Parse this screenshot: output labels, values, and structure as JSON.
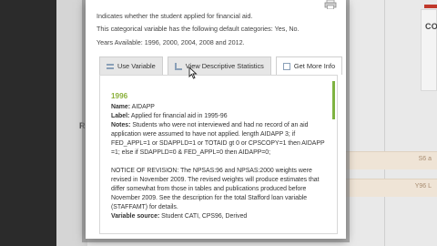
{
  "background": {
    "right_heading": "COU",
    "mid_label": "RC",
    "row_text_1": "S6 a",
    "row_text_2": "Y96 L"
  },
  "modal": {
    "desc_line_1": "Indicates whether the student applied for financial aid.",
    "desc_line_2": "This categorical variable has the following default categories: Yes, No.",
    "desc_line_3": "Years Available: 1996, 2000, 2004, 2008 and 2012.",
    "tabs": [
      {
        "label": "Use Variable"
      },
      {
        "label": "View Descriptive Statistics"
      },
      {
        "label": "Get More Info"
      }
    ],
    "content": {
      "year": "1996",
      "name_label": "Name:",
      "name_value": "AIDAPP",
      "label_label": "Label:",
      "label_value": "Applied for financial aid in 1995-96",
      "notes_label": "Notes:",
      "notes_value": "Students who were not interviewed and had no record of an aid application were assumed to have not applied. length AIDAPP 3; if FED_APPL=1 or SDAPPLD=1 or TOTAID gt 0 or CPSCOPY=1 then AIDAPP =1; else if SDAPPLD=0 & FED_APPL=0 then AIDAPP=0;",
      "revision_text": "NOTICE OF REVISION: The NPSAS:96 and NPSAS:2000 weights were revised in November 2009. The revised weights will produce estimates that differ somewhat from those in tables and publications produced before November 2009. See the description for the total Stafford loan variable (STAFFAMT) for details.",
      "source_label": "Variable source:",
      "source_value": "Student CATI, CPS96, Derived"
    }
  },
  "colors": {
    "accent_green": "#8bb13c",
    "scroll_green": "#7fb342"
  },
  "icons": [
    "print-icon",
    "list-icon",
    "chart-icon",
    "document-icon",
    "mouse-cursor-icon"
  ]
}
